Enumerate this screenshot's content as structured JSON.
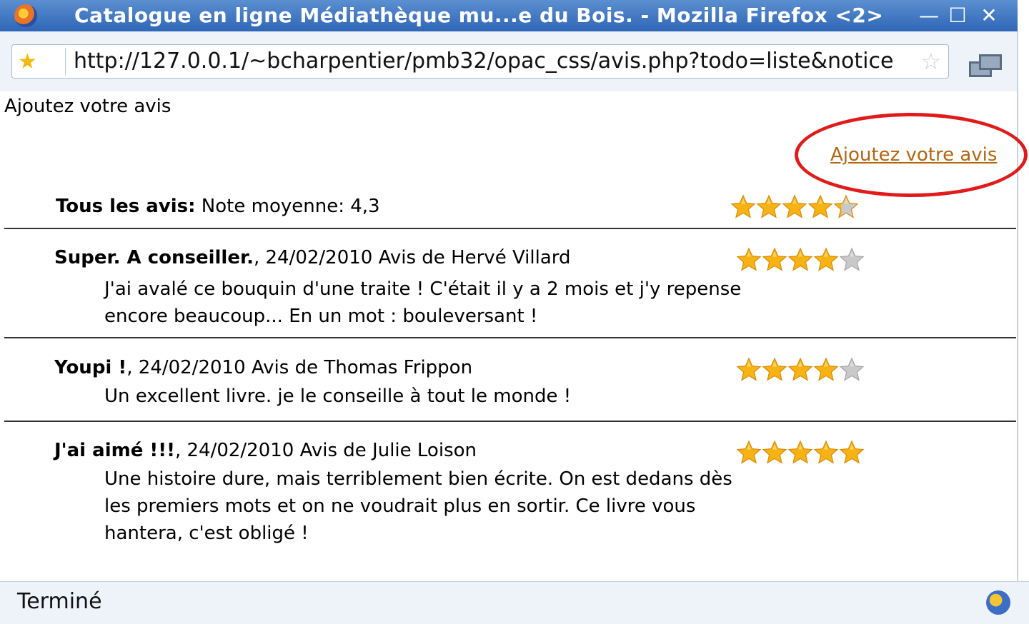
{
  "window": {
    "title": "Catalogue en ligne Médiathèque mu...e du Bois. - Mozilla Firefox <2>",
    "minimize": "—",
    "maximize": "☐",
    "close": "✕"
  },
  "urlbar": {
    "url": "http://127.0.0.1/~bcharpentier/pmb32/opac_css/avis.php?todo=liste&notice",
    "bookmark_star_icon": "star-icon",
    "star_color": "#f5b80c"
  },
  "page": {
    "title": "Ajoutez votre avis",
    "add_review_link": "Ajoutez votre avis",
    "link_color": "#b5650f",
    "highlight_color": "#e11b1b"
  },
  "summary": {
    "label": "Tous les avis:",
    "average_text": " Note moyenne: 4,3",
    "rating": 4.3,
    "max": 5
  },
  "reviews": [
    {
      "title": "Super. A conseiller.",
      "meta": ", 24/02/2010 Avis de Hervé Villard",
      "rating": 4,
      "body": "J'ai avalé ce bouquin d'une traite ! C'était il y a 2 mois et j'y repense encore beaucoup... En un mot : bouleversant !"
    },
    {
      "title": "Youpi !",
      "meta": ", 24/02/2010 Avis de Thomas Frippon",
      "rating": 4,
      "body": "Un excellent livre. je le conseille à tout le monde !"
    },
    {
      "title": "J'ai aimé !!!",
      "meta": ", 24/02/2010 Avis de Julie Loison",
      "rating": 5,
      "body": "Une histoire dure, mais terriblement bien écrite. On est dedans dès les premiers mots et on ne voudrait plus en sortir. Ce livre vous hantera, c'est obligé !"
    }
  ],
  "statusbar": {
    "text": "Terminé"
  }
}
